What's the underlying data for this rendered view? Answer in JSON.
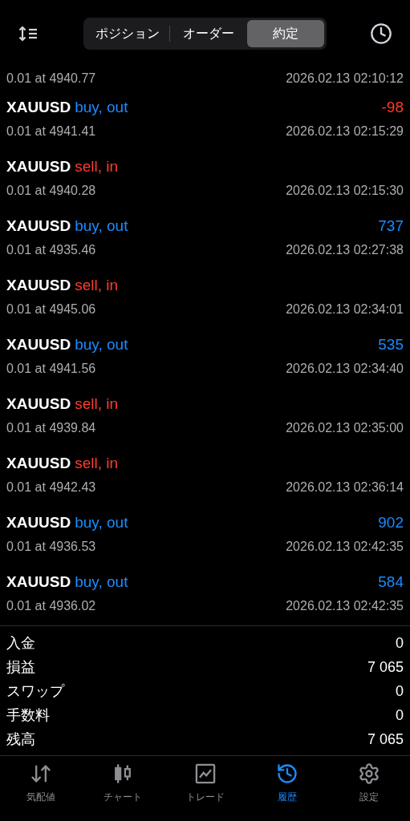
{
  "tabs": [
    {
      "label": "ポジション",
      "selected": false
    },
    {
      "label": "オーダー",
      "selected": false
    },
    {
      "label": "約定",
      "selected": true
    }
  ],
  "partial_deal": {
    "detail": "0.01 at 4940.77",
    "time": "2026.02.13 02:10:12"
  },
  "deals": [
    {
      "symbol": "XAUUSD",
      "action": "buy, out",
      "kind": "buy",
      "profit": {
        "text": "-98",
        "kind": "loss"
      },
      "detail": "0.01 at 4941.41",
      "time": "2026.02.13 02:15:29"
    },
    {
      "symbol": "XAUUSD",
      "action": "sell, in",
      "kind": "sell",
      "detail": "0.01 at 4940.28",
      "time": "2026.02.13 02:15:30"
    },
    {
      "symbol": "XAUUSD",
      "action": "buy, out",
      "kind": "buy",
      "profit": {
        "text": "737",
        "kind": "gain"
      },
      "detail": "0.01 at 4935.46",
      "time": "2026.02.13 02:27:38"
    },
    {
      "symbol": "XAUUSD",
      "action": "sell, in",
      "kind": "sell",
      "detail": "0.01 at 4945.06",
      "time": "2026.02.13 02:34:01"
    },
    {
      "symbol": "XAUUSD",
      "action": "buy, out",
      "kind": "buy",
      "profit": {
        "text": "535",
        "kind": "gain"
      },
      "detail": "0.01 at 4941.56",
      "time": "2026.02.13 02:34:40"
    },
    {
      "symbol": "XAUUSD",
      "action": "sell, in",
      "kind": "sell",
      "detail": "0.01 at 4939.84",
      "time": "2026.02.13 02:35:00"
    },
    {
      "symbol": "XAUUSD",
      "action": "sell, in",
      "kind": "sell",
      "detail": "0.01 at 4942.43",
      "time": "2026.02.13 02:36:14"
    },
    {
      "symbol": "XAUUSD",
      "action": "buy, out",
      "kind": "buy",
      "profit": {
        "text": "902",
        "kind": "gain"
      },
      "detail": "0.01 at 4936.53",
      "time": "2026.02.13 02:42:35"
    },
    {
      "symbol": "XAUUSD",
      "action": "buy, out",
      "kind": "buy",
      "profit": {
        "text": "584",
        "kind": "gain"
      },
      "detail": "0.01 at 4936.02",
      "time": "2026.02.13 02:42:35"
    }
  ],
  "summary": [
    {
      "label": "入金",
      "value": "0"
    },
    {
      "label": "損益",
      "value": "7 065"
    },
    {
      "label": "スワップ",
      "value": "0"
    },
    {
      "label": "手数料",
      "value": "0"
    },
    {
      "label": "残高",
      "value": "7 065"
    }
  ],
  "nav": [
    {
      "kind": "quotes",
      "label": "気配値",
      "selected": false
    },
    {
      "kind": "chart",
      "label": "チャート",
      "selected": false
    },
    {
      "kind": "trade",
      "label": "トレード",
      "selected": false
    },
    {
      "kind": "history",
      "label": "履歴",
      "selected": true
    },
    {
      "kind": "settings",
      "label": "設定",
      "selected": false
    }
  ]
}
